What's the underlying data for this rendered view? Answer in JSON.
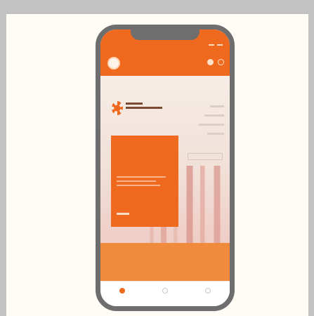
{
  "app": {
    "name": "",
    "accent_color": "#ef6a1e"
  },
  "status_icons": [
    "signal-icon",
    "battery-icon"
  ],
  "appbar_icons": [
    "user-icon",
    "menu-icon"
  ],
  "promo": {
    "title": "",
    "link_text": ""
  },
  "band": {
    "text": ""
  },
  "tabs": [
    {
      "label": "",
      "icon": "home-icon",
      "active": true
    },
    {
      "label": "",
      "icon": "list-icon",
      "active": false
    },
    {
      "label": "",
      "icon": "profile-icon",
      "active": false
    }
  ]
}
